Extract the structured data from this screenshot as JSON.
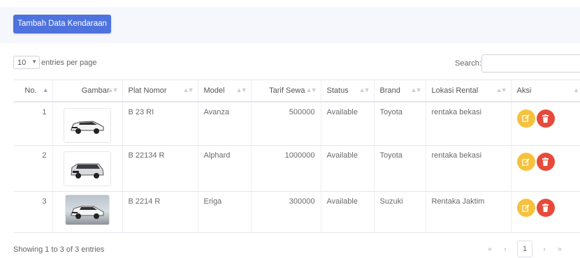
{
  "toolbar": {
    "add_label": "Tambah Data Kendaraan"
  },
  "controls": {
    "length_value": "10",
    "length_suffix": "entries per page",
    "search_label": "Search:",
    "search_value": ""
  },
  "table": {
    "headers": [
      "No.",
      "Gambar",
      "Plat Nomor",
      "Model",
      "Tarif Sewa",
      "Status",
      "Brand",
      "Lokasi Rental",
      "Aksi"
    ],
    "rows": [
      {
        "no": "1",
        "image": "car-photo-white-suv",
        "plate": "B 23 RI",
        "model": "Avanza",
        "rate": "500000",
        "status": "Available",
        "brand": "Toyota",
        "location": "rentaka bekasi"
      },
      {
        "no": "2",
        "image": "car-photo-silver-van",
        "plate": "B 22134 R",
        "model": "Alphard",
        "rate": "1000000",
        "status": "Available",
        "brand": "Toyota",
        "location": "rentaka bekasi"
      },
      {
        "no": "3",
        "image": "car-photo-white-mpv",
        "plate": "B 2214 R",
        "model": "Eriga",
        "rate": "300000",
        "status": "Available",
        "brand": "Suzuki",
        "location": "Rentaka Jaktim"
      }
    ]
  },
  "footer": {
    "info": "Showing 1 to 3 of 3 entries",
    "pagination": {
      "first": "«",
      "prev": "‹",
      "current": "1",
      "next": "›",
      "last": "»"
    }
  },
  "colors": {
    "primary": "#4e73df",
    "warning": "#f6c23e",
    "danger": "#e74a3b"
  },
  "icons": {
    "edit": "edit-icon",
    "delete": "trash-icon"
  }
}
